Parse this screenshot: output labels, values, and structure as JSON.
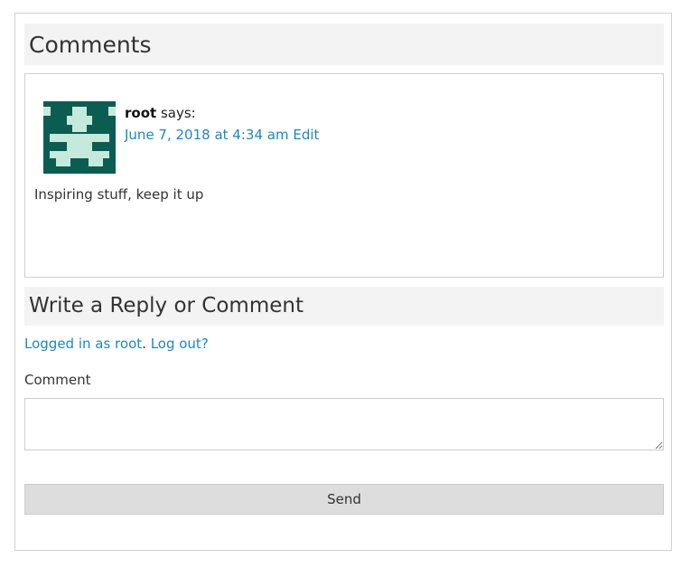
{
  "comments_section": {
    "title": "Comments",
    "comment": {
      "author": "root",
      "says": "says:",
      "date": "June 7, 2018 at 4:34 am",
      "edit_label": "Edit",
      "text": "Inspiring stuff, keep it up",
      "avatar_colors": {
        "dark": "#0b5d52",
        "light": "#c5eadb"
      }
    }
  },
  "reply_section": {
    "title": "Write a Reply or Comment",
    "logged_in_link": "Logged in as root",
    "separator": ".",
    "logout_link": "Log out?",
    "comment_label": "Comment",
    "comment_placeholder": "",
    "send_label": "Send"
  }
}
